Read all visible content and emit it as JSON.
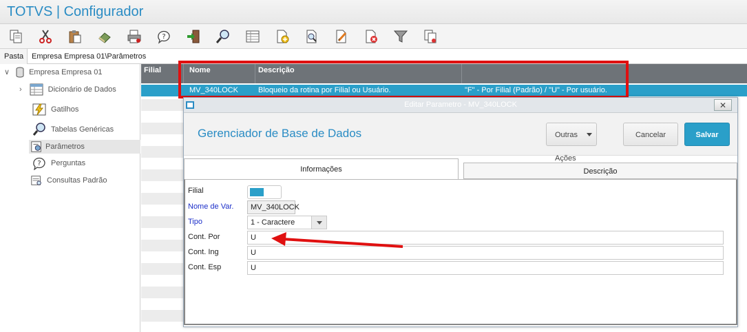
{
  "app": {
    "title": "TOTVS | Configurador"
  },
  "toolbar": {
    "buttons": [
      {
        "name": "copy-icon"
      },
      {
        "name": "cut-icon"
      },
      {
        "name": "paste-icon"
      },
      {
        "name": "eraser-icon"
      },
      {
        "name": "print-icon"
      },
      {
        "name": "help-icon"
      },
      {
        "name": "exit-icon"
      },
      {
        "name": "search-icon"
      },
      {
        "name": "table-icon"
      },
      {
        "name": "add-document-icon"
      },
      {
        "name": "preview-icon"
      },
      {
        "name": "edit-icon"
      },
      {
        "name": "delete-document-icon"
      },
      {
        "name": "filter-icon"
      },
      {
        "name": "documents-icon"
      }
    ]
  },
  "pasta": {
    "label": "Pasta",
    "path": "Empresa Empresa 01\\Parâmetros"
  },
  "tree": {
    "root": "Empresa Empresa 01",
    "items": [
      {
        "label": "Dicionário de Dados",
        "icon": "table-icon"
      },
      {
        "label": "Gatilhos",
        "icon": "lightning-icon"
      },
      {
        "label": "Tabelas Genéricas",
        "icon": "search-icon"
      },
      {
        "label": "Parâmetros",
        "icon": "parameters-icon"
      },
      {
        "label": "Perguntas",
        "icon": "question-icon"
      },
      {
        "label": "Consultas Padrão",
        "icon": "query-icon"
      }
    ]
  },
  "grid": {
    "columns": [
      "Filial",
      "Nome",
      "Descrição",
      ""
    ],
    "selected_row": {
      "filial": "",
      "nome": "MV_340LOCK",
      "descricao": "Bloqueio da rotina por Filial ou Usuário.",
      "extra": "\"F\" - Por Filial (Padrão) / \"U\" - Por usuário."
    }
  },
  "dialog": {
    "window_title": "Editar Parametro - MV_340LOCK",
    "header_title": "Gerenciador de Base de Dados",
    "buttons": {
      "outras": "Outras Ações",
      "cancelar": "Cancelar",
      "salvar": "Salvar"
    },
    "tabs": {
      "info": "Informações",
      "desc": "Descrição"
    },
    "form": {
      "filial_label": "Filial",
      "nome_label": "Nome de Var.",
      "nome_value": "MV_340LOCK",
      "tipo_label": "Tipo",
      "tipo_value": "1 - Caractere",
      "por_label": "Cont. Por",
      "por_value": "U",
      "ing_label": "Cont. Ing",
      "ing_value": "U",
      "esp_label": "Cont. Esp",
      "esp_value": "U"
    }
  },
  "colors": {
    "accent": "#2a9fc9",
    "highlight": "#e01010"
  }
}
